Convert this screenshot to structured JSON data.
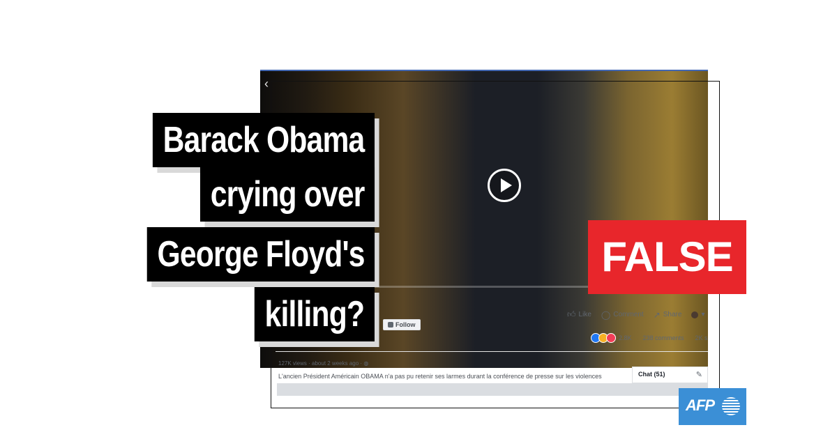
{
  "headline": {
    "lines": [
      "Barack Obama",
      "crying over",
      "George Floyd's",
      "killing?"
    ]
  },
  "verdict": {
    "label": "FALSE",
    "color": "#e8262b"
  },
  "brand": {
    "logo_text": "AFP",
    "color": "#3b8fd6"
  },
  "video_post": {
    "back_icon": "chevron-left-icon",
    "play_icon": "play-icon",
    "follow_label": "Follow",
    "actions": {
      "like_label": "Like",
      "comment_label": "Comment",
      "share_label": "Share"
    },
    "reactions": {
      "icons": [
        "like-reaction-icon",
        "sad-reaction-icon",
        "love-reaction-icon"
      ],
      "count": "2.8K",
      "comments": "238 comments",
      "shares": "2K s"
    },
    "views": "127K views",
    "time": "about 2 weeks ago",
    "caption": "L'ancien Président Américain OBAMA n'a pas pu retenir ses larmes durant la conférence de presse sur les violences",
    "chat_label": "Chat (51)"
  }
}
